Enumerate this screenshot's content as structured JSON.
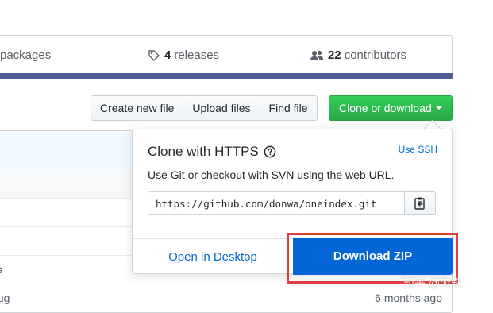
{
  "stats": {
    "packages_label": "packages",
    "releases_count": "4",
    "releases_label": "releases",
    "contributors_count": "22",
    "contributors_label": "contributors",
    "language_bar_color": "#4f5d95"
  },
  "toolbar": {
    "create_file": "Create new file",
    "upload_files": "Upload files",
    "find_file": "Find file",
    "clone_download": "Clone or download"
  },
  "file_rows": [
    {
      "name": "",
      "age": ""
    },
    {
      "name": "",
      "age": ""
    },
    {
      "name": "",
      "age": ""
    },
    {
      "name": "ys",
      "age": ""
    },
    {
      "name": "bug",
      "age": "6 months ago"
    }
  ],
  "clone_popup": {
    "title": "Clone with HTTPS",
    "use_ssh": "Use SSH",
    "description": "Use Git or checkout with SVN using the web URL.",
    "url": "https://github.com/donwa/oneindex.git",
    "open_desktop": "Open in Desktop",
    "download_zip": "Download ZIP"
  },
  "watermark": "知乎 @游轶",
  "icons": {
    "releases": "tag-icon",
    "contributors": "people-icon",
    "help": "question-icon",
    "copy": "clipboard-icon"
  },
  "colors": {
    "primary_green": "#28a745",
    "link_blue": "#0366d6",
    "highlight_red": "#e0403c"
  }
}
